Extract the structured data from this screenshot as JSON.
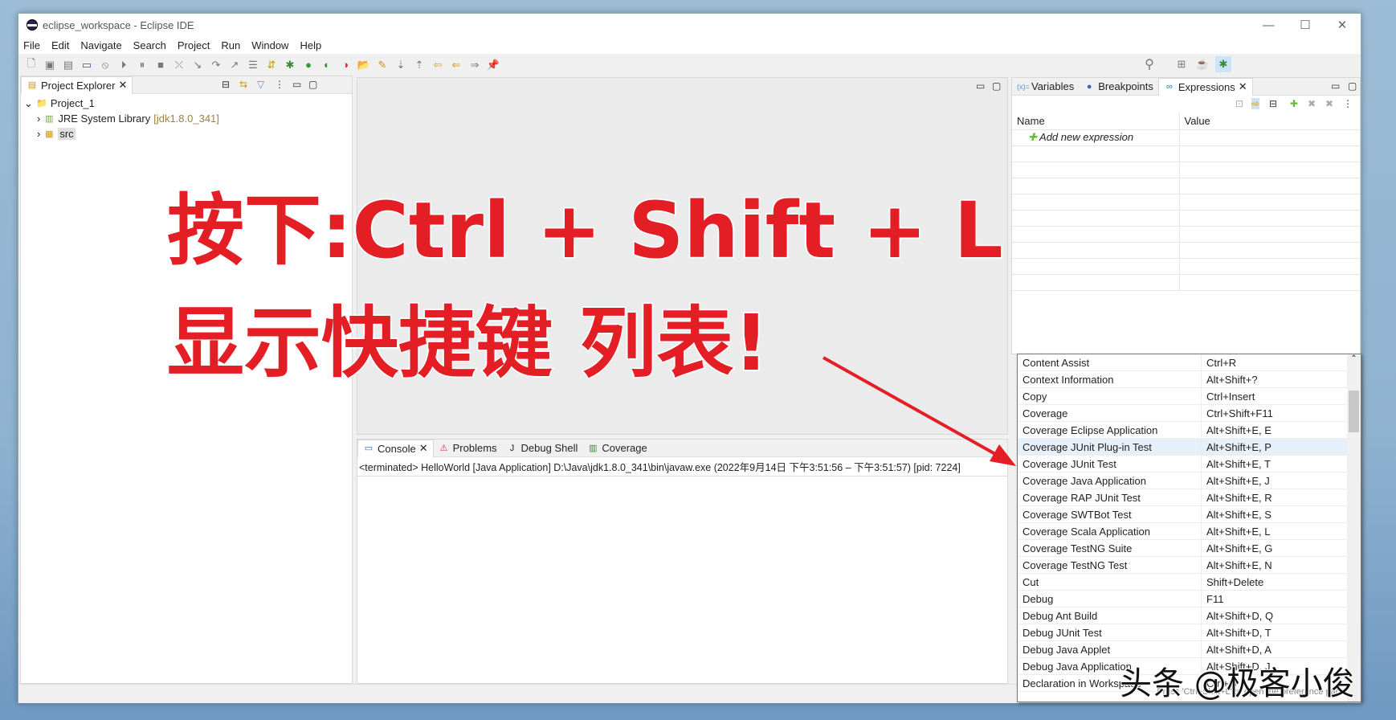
{
  "window": {
    "title": "eclipse_workspace - Eclipse IDE",
    "minimize": "—",
    "maximize": "☐",
    "close": "✕"
  },
  "menu": [
    "File",
    "Edit",
    "Navigate",
    "Search",
    "Project",
    "Run",
    "Window",
    "Help"
  ],
  "project_explorer": {
    "tab": "Project Explorer",
    "project": "Project_1",
    "jre": "JRE System Library",
    "jre_version": "[jdk1.8.0_341]",
    "src": "src"
  },
  "debug_views": {
    "tabs": [
      "Variables",
      "Breakpoints",
      "Expressions"
    ],
    "col_name": "Name",
    "col_value": "Value",
    "add_expression": "Add new expression"
  },
  "console": {
    "tabs": [
      "Console",
      "Problems",
      "Debug Shell",
      "Coverage"
    ],
    "status": "<terminated> HelloWorld [Java Application] D:\\Java\\jdk1.8.0_341\\bin\\javaw.exe  (2022年9月14日 下午3:51:56 – 下午3:51:57) [pid: 7224]"
  },
  "shortcuts": {
    "rows": [
      {
        "cmd": "Content Assist",
        "key": "Ctrl+R"
      },
      {
        "cmd": "Context Information",
        "key": "Alt+Shift+?"
      },
      {
        "cmd": "Copy",
        "key": "Ctrl+Insert"
      },
      {
        "cmd": "Coverage",
        "key": "Ctrl+Shift+F11"
      },
      {
        "cmd": "Coverage Eclipse Application",
        "key": "Alt+Shift+E, E"
      },
      {
        "cmd": "Coverage JUnit Plug-in Test",
        "key": "Alt+Shift+E, P"
      },
      {
        "cmd": "Coverage JUnit Test",
        "key": "Alt+Shift+E, T"
      },
      {
        "cmd": "Coverage Java Application",
        "key": "Alt+Shift+E, J"
      },
      {
        "cmd": "Coverage RAP JUnit Test",
        "key": "Alt+Shift+E, R"
      },
      {
        "cmd": "Coverage SWTBot Test",
        "key": "Alt+Shift+E, S"
      },
      {
        "cmd": "Coverage Scala Application",
        "key": "Alt+Shift+E, L"
      },
      {
        "cmd": "Coverage TestNG Suite",
        "key": "Alt+Shift+E, G"
      },
      {
        "cmd": "Coverage TestNG Test",
        "key": "Alt+Shift+E, N"
      },
      {
        "cmd": "Cut",
        "key": "Shift+Delete"
      },
      {
        "cmd": "Debug",
        "key": "F11"
      },
      {
        "cmd": "Debug Ant Build",
        "key": "Alt+Shift+D, Q"
      },
      {
        "cmd": "Debug JUnit Test",
        "key": "Alt+Shift+D, T"
      },
      {
        "cmd": "Debug Java Applet",
        "key": "Alt+Shift+D, A"
      },
      {
        "cmd": "Debug Java Application",
        "key": "Alt+Shift+D, J"
      },
      {
        "cmd": "Declaration in Workspace",
        "key": "Ctrl+G"
      }
    ],
    "selected": 5,
    "footer": "Press 'Ctrl+Shift+L' to open the preference page"
  },
  "overlay": {
    "line1": "按下:Ctrl + Shift + L",
    "line2": "显示快捷键 列表!",
    "watermark": "头条 @极客小俊",
    "color": "#e41e25"
  }
}
